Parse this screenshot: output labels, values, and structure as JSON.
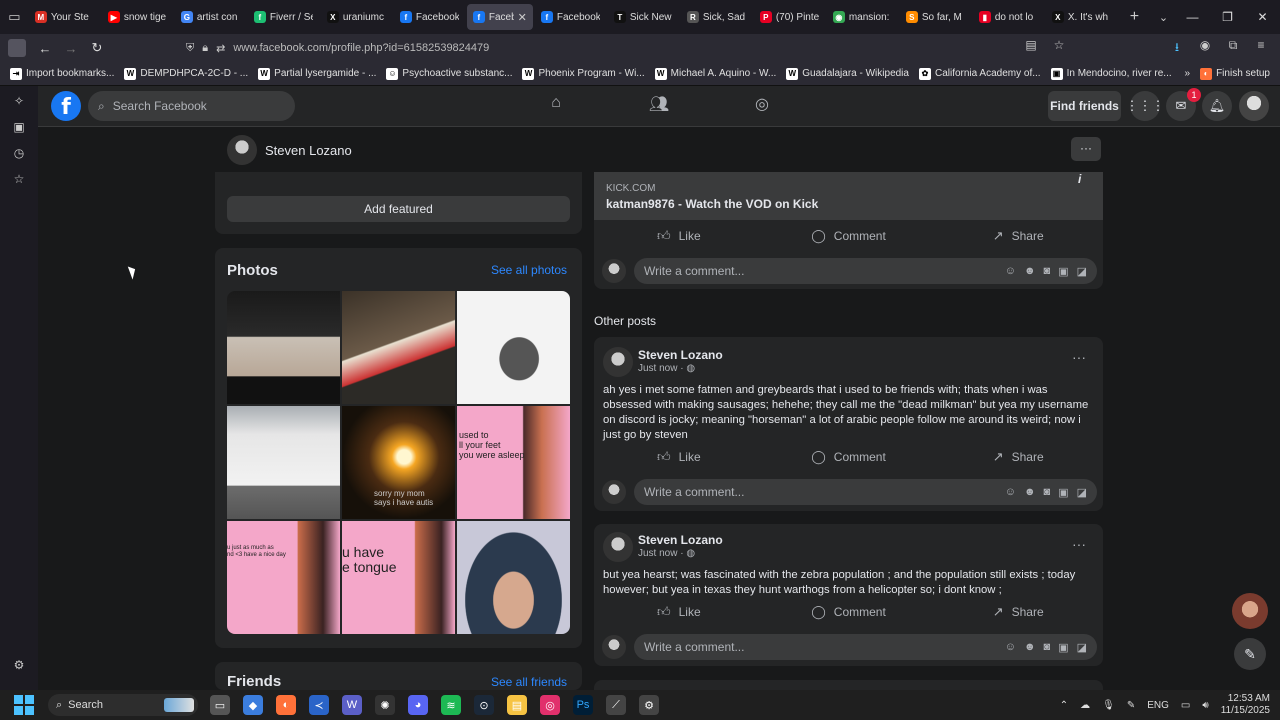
{
  "browser": {
    "tabs": [
      {
        "label": "Your Ste",
        "color": "#d93025",
        "glyph": "M"
      },
      {
        "label": "snow tige",
        "color": "#ff0000",
        "glyph": "▶"
      },
      {
        "label": "artist con",
        "color": "#4285f4",
        "glyph": "G"
      },
      {
        "label": "Fiverr / Se",
        "color": "#1dbf73",
        "glyph": "f"
      },
      {
        "label": "uraniumc",
        "color": "#111111",
        "glyph": "X"
      },
      {
        "label": "Facebook",
        "color": "#1877f2",
        "glyph": "f"
      },
      {
        "label": "Facebo",
        "color": "#1877f2",
        "glyph": "f",
        "active": true
      },
      {
        "label": "Facebook",
        "color": "#1877f2",
        "glyph": "f"
      },
      {
        "label": "Sick New",
        "color": "#111111",
        "glyph": "T"
      },
      {
        "label": "Sick, Sad",
        "color": "#555555",
        "glyph": "R"
      },
      {
        "label": "(70) Pinte",
        "color": "#e60023",
        "glyph": "P"
      },
      {
        "label": "mansion:",
        "color": "#34a853",
        "glyph": "◉"
      },
      {
        "label": "So far, M",
        "color": "#ff8c00",
        "glyph": "S"
      },
      {
        "label": "do not lo",
        "color": "#e60023",
        "glyph": "▮"
      },
      {
        "label": "X. It's wh",
        "color": "#111111",
        "glyph": "X"
      }
    ],
    "tab_close": "✕",
    "url": "www.facebook.com/profile.php?id=61582539824479",
    "bookmarks": [
      {
        "label": "Import bookmarks...",
        "glyph": "⇥"
      },
      {
        "label": "DEMPDHPCA-2C-D - ...",
        "glyph": "W"
      },
      {
        "label": "Partial lysergamide - ...",
        "glyph": "W"
      },
      {
        "label": "Psychoactive substanc...",
        "glyph": "☺"
      },
      {
        "label": "Phoenix Program - Wi...",
        "glyph": "W"
      },
      {
        "label": "Michael A. Aquino - W...",
        "glyph": "W"
      },
      {
        "label": "Guadalajara - Wikipedia",
        "glyph": "W"
      },
      {
        "label": "California Academy of...",
        "glyph": "✿"
      },
      {
        "label": "In Mendocino, river re...",
        "glyph": "▣"
      }
    ],
    "finish_setup": "Finish setup"
  },
  "fb": {
    "search_placeholder": "Search Facebook",
    "find_friends": "Find friends",
    "notification_count": "1",
    "profile_name": "Steven Lozano",
    "add_featured": "Add featured",
    "photos_title": "Photos",
    "see_all_photos": "See all photos",
    "friends_title": "Friends",
    "see_all_friends": "See all friends",
    "photo_captions": {
      "p6": "used to\nll your feet\nyou were asleep",
      "p7": "u just as much as\nnd <3 have a nice day",
      "p8": "u have\ne tongue",
      "p5": "sorry my mom\nsays i have autis"
    },
    "other_posts_label": "Other posts",
    "actions": {
      "like": "Like",
      "comment": "Comment",
      "share": "Share"
    },
    "comment_placeholder": "Write a comment...",
    "link_post": {
      "source": "KICK.COM",
      "title": "katman9876 - Watch the VOD on Kick"
    },
    "posts": [
      {
        "author": "Steven Lozano",
        "time": "Just now ·",
        "body": "ah yes i met some fatmen and greybeards that i used to be friends with; thats when i was obsessed with making sausages; hehehe; they call me the \"dead milkman\" but yea my username on discord is jocky; meaning \"horseman\" a lot of arabic people follow me around its weird; now i just go by steven"
      },
      {
        "author": "Steven Lozano",
        "time": "Just now ·",
        "body": "but yea hearst; was fascinated with the zebra population ; and the population still exists ; today however; but yea in texas they hunt warthogs from a helicopter so; i dont know ;"
      }
    ]
  },
  "taskbar": {
    "search": "Search",
    "lang": "ENG",
    "time": "12:53 AM",
    "date": "11/15/2025"
  }
}
